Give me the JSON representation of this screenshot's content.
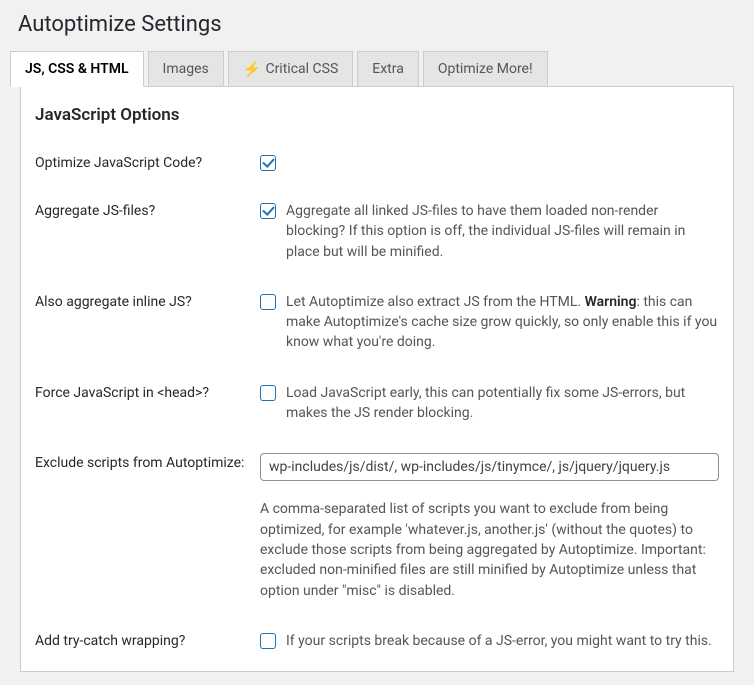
{
  "header": {
    "title": "Autoptimize Settings"
  },
  "tabs": [
    {
      "label": "JS, CSS & HTML",
      "active": true,
      "icon": null
    },
    {
      "label": "Images",
      "active": false,
      "icon": null
    },
    {
      "label": "Critical CSS",
      "active": false,
      "icon": "lightning"
    },
    {
      "label": "Extra",
      "active": false,
      "icon": null
    },
    {
      "label": "Optimize More!",
      "active": false,
      "icon": null
    }
  ],
  "section": {
    "title": "JavaScript Options"
  },
  "options": {
    "optimize_js": {
      "label": "Optimize JavaScript Code?",
      "checked": true
    },
    "aggregate_js": {
      "label": "Aggregate JS-files?",
      "checked": true,
      "desc": "Aggregate all linked JS-files to have them loaded non-render blocking? If this option is off, the individual JS-files will remain in place but will be minified."
    },
    "aggregate_inline": {
      "label": "Also aggregate inline JS?",
      "checked": false,
      "desc_pre": "Let Autoptimize also extract JS from the HTML. ",
      "desc_bold": "Warning",
      "desc_post": ": this can make Autoptimize's cache size grow quickly, so only enable this if you know what you're doing."
    },
    "force_head": {
      "label": "Force JavaScript in <head>?",
      "checked": false,
      "desc": "Load JavaScript early, this can potentially fix some JS-errors, but makes the JS render blocking."
    },
    "exclude": {
      "label": "Exclude scripts from Autoptimize:",
      "value": "wp-includes/js/dist/, wp-includes/js/tinymce/, js/jquery/jquery.js",
      "help": "A comma-separated list of scripts you want to exclude from being optimized, for example 'whatever.js, another.js' (without the quotes) to exclude those scripts from being aggregated by Autoptimize. Important: excluded non-minified files are still minified by Autoptimize unless that option under \"misc\" is disabled."
    },
    "trycatch": {
      "label": "Add try-catch wrapping?",
      "checked": false,
      "desc": "If your scripts break because of a JS-error, you might want to try this."
    }
  }
}
